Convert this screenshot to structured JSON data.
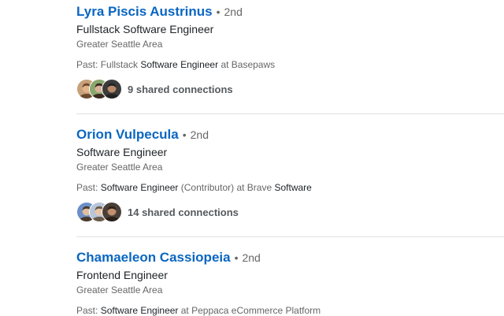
{
  "results": [
    {
      "name": "Lyra Piscis Austrinus",
      "bullet": "•",
      "degree": "2nd",
      "headline": "Fullstack Software Engineer",
      "location": "Greater Seattle Area",
      "past": {
        "prefix": "Past: ",
        "segments": [
          "Fullstack ",
          "Software Engineer",
          " at Basepaws"
        ]
      },
      "shared_connections": "9 shared connections",
      "avatars": [
        {
          "bg": "#c8a07a",
          "skin": "#e2b48a",
          "hair": "#6b4a2e"
        },
        {
          "bg": "#8aa86e",
          "skin": "#d9b29a",
          "hair": "#3a2a20"
        },
        {
          "bg": "#3b3b3b",
          "skin": "#b98a6a",
          "hair": "#222222"
        }
      ]
    },
    {
      "name": "Orion Vulpecula",
      "bullet": "•",
      "degree": "2nd",
      "headline": "Software Engineer",
      "location": "Greater Seattle Area",
      "past": {
        "prefix": "Past: ",
        "segments": [
          "Software Engineer",
          " (Contributor) at Brave ",
          "Software"
        ]
      },
      "shared_connections": "14 shared connections",
      "avatars": [
        {
          "bg": "#6c8fc7",
          "skin": "#e0bea0",
          "hair": "#4a3a2a"
        },
        {
          "bg": "#b7c6d8",
          "skin": "#e8c6a8",
          "hair": "#6a5a4a"
        },
        {
          "bg": "#4a4038",
          "skin": "#c09070",
          "hair": "#2a2018"
        }
      ]
    },
    {
      "name": "Chamaeleon Cassiopeia",
      "bullet": "•",
      "degree": "2nd",
      "headline": "Frontend Engineer",
      "location": "Greater Seattle Area",
      "past": {
        "prefix": "Past: ",
        "segments": [
          "Software Engineer",
          " at Peppaca eCommerce Platform"
        ]
      },
      "shared_connections": "",
      "avatars": []
    }
  ]
}
